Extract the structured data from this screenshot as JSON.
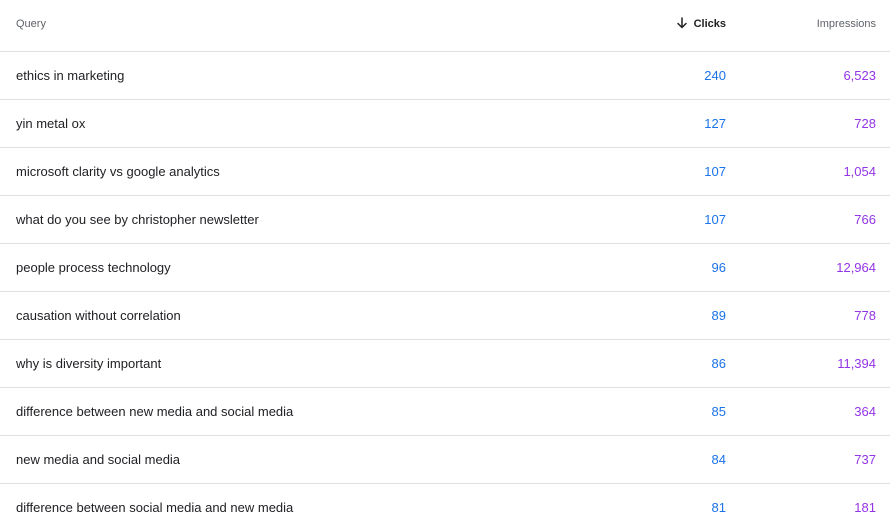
{
  "header": {
    "query_label": "Query",
    "clicks_label": "Clicks",
    "impressions_label": "Impressions",
    "sort_icon": "arrow-down-icon"
  },
  "colors": {
    "clicks": "#1a73e8",
    "impressions": "#9334e6",
    "divider": "#e0e0e0"
  },
  "rows": [
    {
      "query": "ethics in marketing",
      "clicks": "240",
      "impressions": "6,523"
    },
    {
      "query": "yin metal ox",
      "clicks": "127",
      "impressions": "728"
    },
    {
      "query": "microsoft clarity vs google analytics",
      "clicks": "107",
      "impressions": "1,054"
    },
    {
      "query": "what do you see by christopher newsletter",
      "clicks": "107",
      "impressions": "766"
    },
    {
      "query": "people process technology",
      "clicks": "96",
      "impressions": "12,964"
    },
    {
      "query": "causation without correlation",
      "clicks": "89",
      "impressions": "778"
    },
    {
      "query": "why is diversity important",
      "clicks": "86",
      "impressions": "11,394"
    },
    {
      "query": "difference between new media and social media",
      "clicks": "85",
      "impressions": "364"
    },
    {
      "query": "new media and social media",
      "clicks": "84",
      "impressions": "737"
    },
    {
      "query": "difference between social media and new media",
      "clicks": "81",
      "impressions": "181"
    }
  ]
}
